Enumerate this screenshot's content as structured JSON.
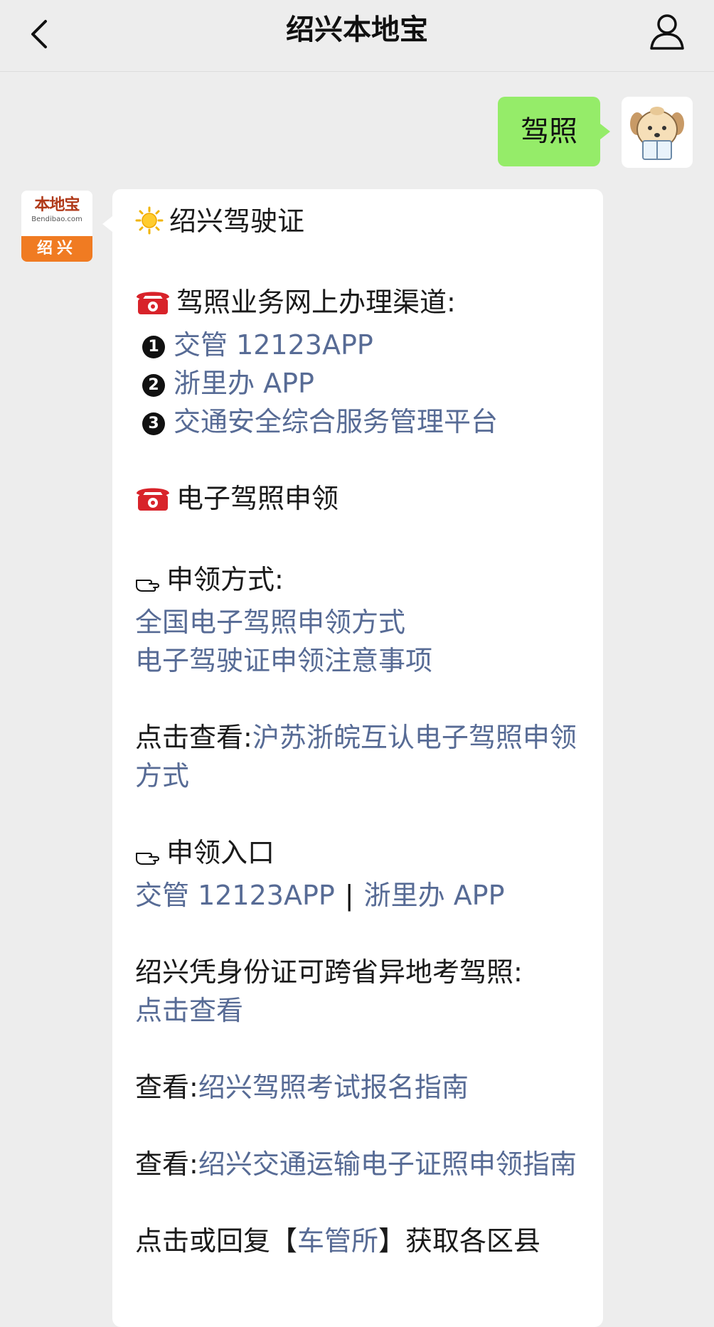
{
  "header": {
    "title": "绍兴本地宝"
  },
  "sent_message": {
    "text": "驾照"
  },
  "bot_avatar": {
    "brand": "本地宝",
    "url": "Bendibao.com",
    "city": "绍兴"
  },
  "message": {
    "heading": "绍兴驾驶证",
    "section1_title": "驾照业务网上办理渠道:",
    "channels": [
      {
        "num": "1",
        "text": "交管 12123APP"
      },
      {
        "num": "2",
        "text": "浙里办 APP"
      },
      {
        "num": "3",
        "text": "交通安全综合服务管理平台"
      }
    ],
    "section2_title": "电子驾照申领",
    "method_title": "申领方式:",
    "method_links": [
      "全国电子驾照申领方式",
      "电子驾驶证申领注意事项"
    ],
    "click_view_prefix": "点击查看:",
    "click_view_link": "沪苏浙皖互认电子驾照申领方式",
    "entry_title": "申领入口",
    "entry_link1": "交管 12123APP",
    "entry_sep": "|",
    "entry_link2": "浙里办 APP",
    "cross_province_text": "绍兴凭身份证可跨省异地考驾照:",
    "cross_province_link": "点击查看",
    "view_prefix": "查看:",
    "view_link1": "绍兴驾照考试报名指南",
    "view_link2": "绍兴交通运输电子证照申领指南",
    "reply_prefix": "点击或回复【",
    "reply_link": "车管所",
    "reply_suffix": "】获取各区县"
  },
  "colors": {
    "background": "#ededed",
    "sent_bubble": "#95ec69",
    "link": "#576b95"
  }
}
